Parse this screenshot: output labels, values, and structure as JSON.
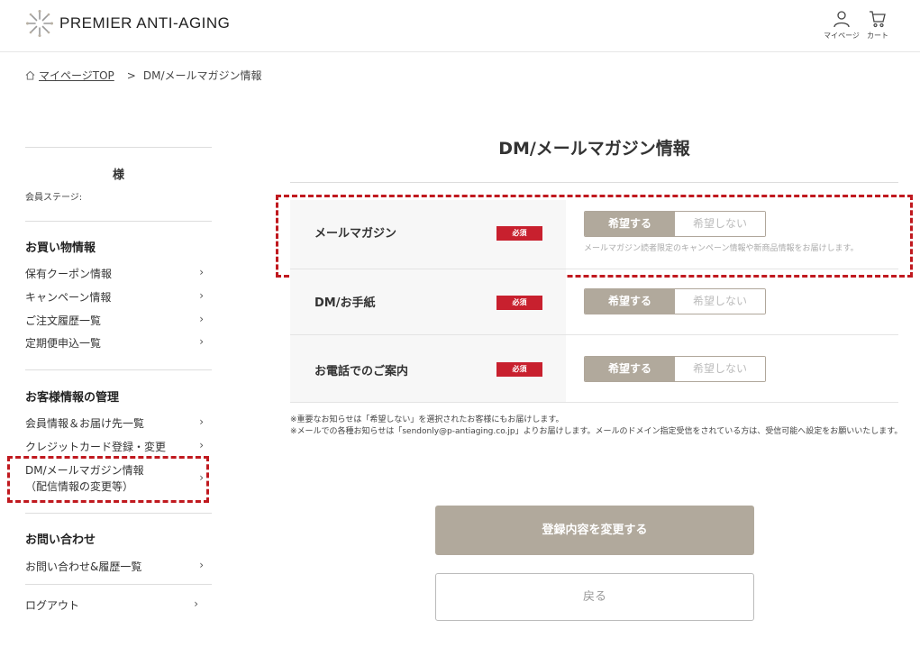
{
  "header": {
    "logo_text": "PREMIER ANTI-AGING",
    "mypage_label": "マイページ",
    "cart_label": "カート"
  },
  "breadcrumb": {
    "home": "マイページTOP",
    "separator": ">",
    "current": "DM/メールマガジン情報"
  },
  "sidebar": {
    "name_suffix": "様",
    "member_stage": "会員ステージ:",
    "sections": [
      {
        "heading": "お買い物情報",
        "items": [
          "保有クーポン情報",
          "キャンペーン情報",
          "ご注文履歴一覧",
          "定期便申込一覧"
        ]
      },
      {
        "heading": "お客様情報の管理",
        "items": [
          "会員情報＆お届け先一覧",
          "クレジットカード登録・変更",
          "DM/メールマガジン情報",
          "（配信情報の変更等）"
        ]
      },
      {
        "heading": "お問い合わせ",
        "items": [
          "お問い合わせ&履歴一覧"
        ]
      }
    ],
    "logout": "ログアウト",
    "chevron": "›"
  },
  "main": {
    "title": "DM/メールマガジン情報",
    "required_badge": "必須",
    "rows": [
      {
        "label": "メールマガジン",
        "option_on": "希望する",
        "option_off": "希望しない",
        "selected": "希望する",
        "note": "メールマガジン読者限定のキャンペーン情報や新商品情報をお届けします。"
      },
      {
        "label": "DM/お手紙",
        "option_on": "希望する",
        "option_off": "希望しない",
        "selected": "希望する"
      },
      {
        "label": "お電話でのご案内",
        "option_on": "希望する",
        "option_off": "希望しない",
        "selected": "希望する"
      }
    ],
    "notes": [
      "※重要なお知らせは「希望しない」を選択されたお客様にもお届けします。",
      "※メールでの各種お知らせは「sendonly@p-antiaging.co.jp」よりお届けします。メールのドメイン指定受信をされている方は、受信可能へ設定をお願いいたします。"
    ],
    "submit_label": "登録内容を変更する",
    "back_label": "戻る"
  },
  "colors": {
    "accent": "#b1a99c",
    "badge": "#c8202e",
    "highlight": "#c0191f"
  }
}
